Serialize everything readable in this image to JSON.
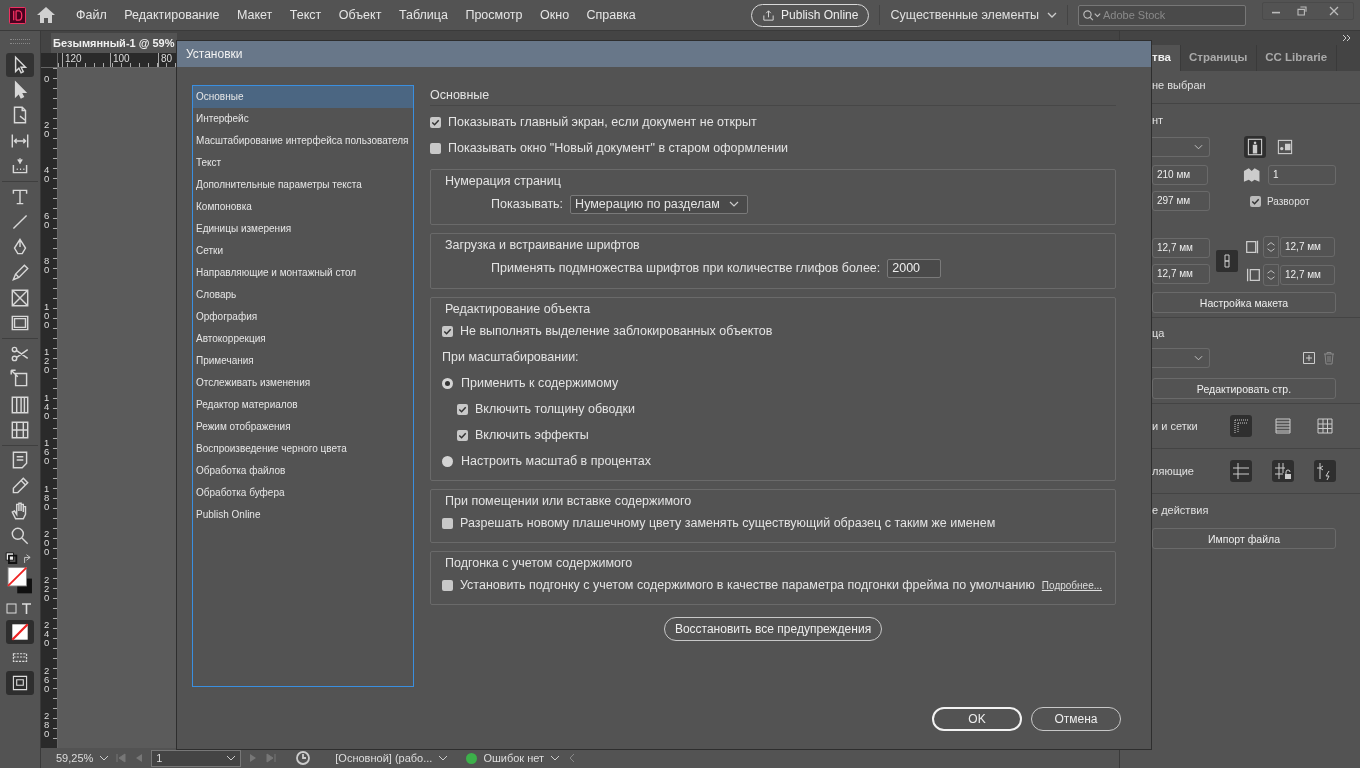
{
  "menu_bar": {
    "items": [
      "Файл",
      "Редактирование",
      "Макет",
      "Текст",
      "Объект",
      "Таблица",
      "Просмотр",
      "Окно",
      "Справка"
    ],
    "publish_button": "Publish Online",
    "workspace": "Существенные элементы",
    "stock_search": {
      "placeholder": "Adobe Stock"
    }
  },
  "document_tab": "Безымянный-1 @ 59%",
  "ruler": {
    "horizontal": [
      "120",
      "100",
      "80"
    ],
    "vertical": [
      "0",
      "20",
      "40",
      "60",
      "80",
      "100",
      "120",
      "140",
      "160",
      "180",
      "200",
      "220",
      "240",
      "260",
      "280"
    ]
  },
  "tools": [
    {
      "kind": "selection",
      "selected": true
    },
    {
      "kind": "direct",
      "selected": false
    },
    {
      "kind": "page",
      "selected": false
    },
    {
      "kind": "gap",
      "selected": false
    },
    {
      "kind": "collector",
      "selected": false
    },
    {
      "kind": "type",
      "selected": false
    },
    {
      "kind": "line",
      "selected": false
    },
    {
      "kind": "pen",
      "selected": false
    },
    {
      "kind": "pencil",
      "selected": false
    },
    {
      "kind": "frame",
      "selected": false
    },
    {
      "kind": "rect",
      "selected": false
    },
    {
      "kind": "scissors",
      "selected": false
    },
    {
      "kind": "transform",
      "selected": false
    },
    {
      "kind": "gradient",
      "selected": false
    },
    {
      "kind": "feather",
      "selected": false
    },
    {
      "kind": "note",
      "selected": false
    },
    {
      "kind": "eyedropper",
      "selected": false
    },
    {
      "kind": "hand",
      "selected": false
    },
    {
      "kind": "zoom",
      "selected": false
    }
  ],
  "right_panel": {
    "tabs": [
      {
        "label": "тва",
        "selected": true
      },
      {
        "label": "Страницы",
        "selected": false
      },
      {
        "label": "CC Librarie",
        "selected": false
      }
    ],
    "status": "не выбран",
    "document_heading": "нт",
    "width": "210 мм",
    "height": "297 мм",
    "page_count": "1",
    "facing_pages": {
      "label": "Разворот",
      "checked": true
    },
    "margins": [
      "12,7 мм",
      "12,7 мм",
      "12,7 мм",
      "12,7 мм"
    ],
    "layout_button": "Настройка макета",
    "page_heading": "ца",
    "edit_page_button": "Редактировать стр.",
    "grids_heading": "и и сетки",
    "guides_heading": "ляющие",
    "actions_heading": "е действия",
    "import_button": "Импорт файла"
  },
  "status_bar": {
    "zoom": "59,25%",
    "page": "1",
    "master": "[Основной] (рабо...",
    "preflight": "Ошибок нет"
  },
  "dialog": {
    "title": "Установки",
    "categories": [
      {
        "label": "Основные",
        "selected": true
      },
      {
        "label": "Интерфейс",
        "selected": false
      },
      {
        "label": "Масштабирование интерфейса пользователя",
        "selected": false
      },
      {
        "label": "Текст",
        "selected": false
      },
      {
        "label": "Дополнительные параметры текста",
        "selected": false
      },
      {
        "label": "Компоновка",
        "selected": false
      },
      {
        "label": "Единицы измерения",
        "selected": false
      },
      {
        "label": "Сетки",
        "selected": false
      },
      {
        "label": "Направляющие и монтажный стол",
        "selected": false
      },
      {
        "label": "Словарь",
        "selected": false
      },
      {
        "label": "Орфография",
        "selected": false
      },
      {
        "label": "Автокоррекция",
        "selected": false
      },
      {
        "label": "Примечания",
        "selected": false
      },
      {
        "label": "Отслеживать изменения",
        "selected": false
      },
      {
        "label": "Редактор материалов",
        "selected": false
      },
      {
        "label": "Режим отображения",
        "selected": false
      },
      {
        "label": "Воспроизведение черного цвета",
        "selected": false
      },
      {
        "label": "Обработка файлов",
        "selected": false
      },
      {
        "label": "Обработка буфера",
        "selected": false
      },
      {
        "label": "Publish Online",
        "selected": false
      }
    ],
    "section_title": "Основные",
    "general_options": [
      {
        "label": "Показывать главный экран, если документ не открыт",
        "checked": true
      },
      {
        "label": "Показывать окно \"Новый документ\" в старом оформлении",
        "checked": false
      }
    ],
    "page_numbering": {
      "title": "Нумерация страниц",
      "label": "Показывать:",
      "value": "Нумерацию по разделам"
    },
    "font_downloading": {
      "title": "Загрузка и встраивание шрифтов",
      "label": "Применять подмножества шрифтов при количестве глифов более:",
      "value": "2000"
    },
    "object_editing": {
      "title": "Редактирование объекта",
      "lock_option": {
        "label": "Не выполнять выделение заблокированных объектов",
        "checked": true
      },
      "scaling_label": "При масштабировании:",
      "scaling": [
        {
          "label": "Применить к содержимому",
          "selected": true,
          "options": [
            {
              "label": "Включить толщину обводки",
              "checked": true
            },
            {
              "label": "Включить эффекты",
              "checked": true
            }
          ]
        },
        {
          "label": "Настроить масштаб в процентах",
          "selected": false
        }
      ]
    },
    "placing": {
      "title": "При помещении или вставке содержимого",
      "option": {
        "label": "Разрешать новому плашечному цвету заменять существующий образец с таким же именем",
        "checked": false
      }
    },
    "content_fitting": {
      "title": "Подгонка с учетом содержимого",
      "option": {
        "label": "Установить подгонку с учетом содержимого в качестве параметра подгонки фрейма по умолчанию",
        "checked": false
      },
      "link": "Подробнее..."
    },
    "reset_button": "Восстановить все предупреждения",
    "buttons": [
      {
        "label": "OK",
        "default": true
      },
      {
        "label": "Отмена",
        "default": false
      }
    ]
  }
}
